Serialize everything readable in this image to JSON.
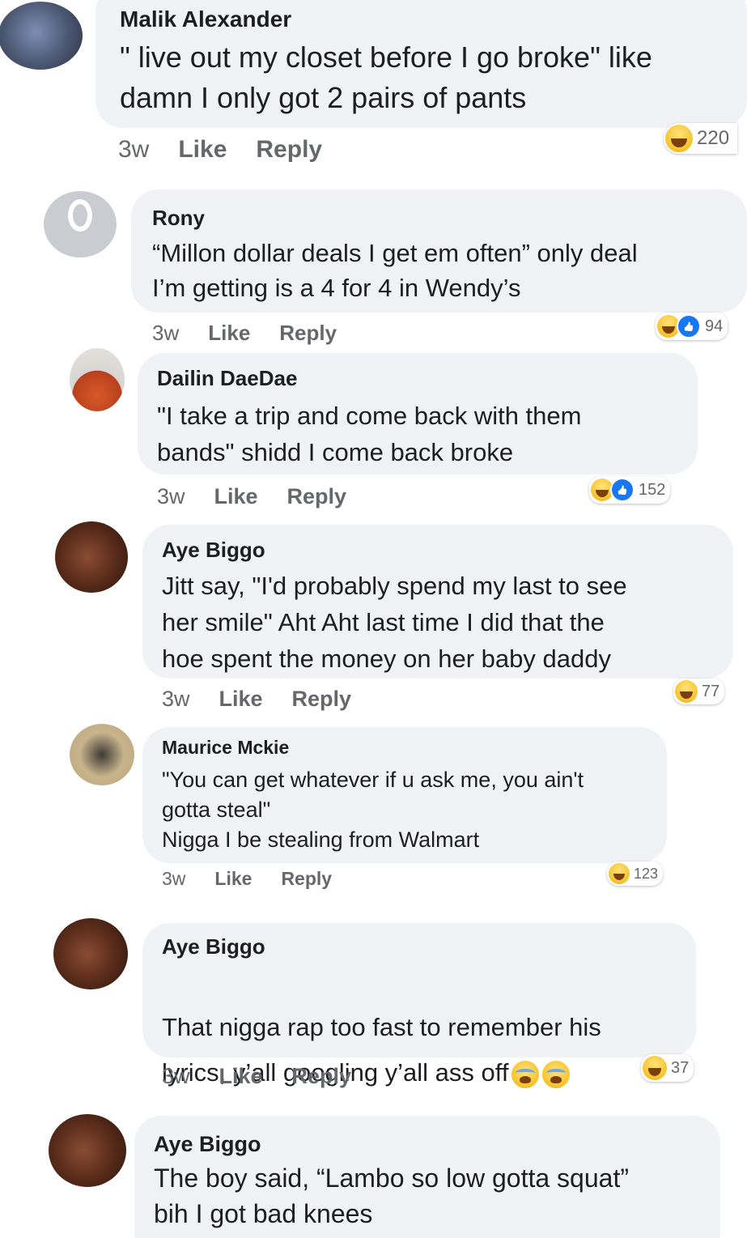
{
  "comments": [
    {
      "name": "Malik Alexander",
      "text": "\" live out my closet before I go broke\" like\ndamn I only got 2 pairs of pants",
      "time": "3w",
      "like": "Like",
      "reply": "Reply",
      "reaction_icons": [
        "haha-icon"
      ],
      "reaction_count": "220"
    },
    {
      "name": "Rony",
      "text": "“Millon dollar deals I get em often” only deal\nI’m getting is a 4 for 4 in Wendy’s",
      "time": "3w",
      "like": "Like",
      "reply": "Reply",
      "reaction_icons": [
        "haha-icon",
        "like-icon"
      ],
      "reaction_count": "94"
    },
    {
      "name": "Dailin DaeDae",
      "text": "\"I take a trip and come back with them\nbands\" shidd I come back broke",
      "time": "3w",
      "like": "Like",
      "reply": "Reply",
      "reaction_icons": [
        "haha-icon",
        "like-icon"
      ],
      "reaction_count": "152"
    },
    {
      "name": "Aye Biggo",
      "text": "Jitt say, \"I'd probably spend my last to see\nher smile\" Aht Aht last time I did that the\nhoe spent the money on her baby daddy",
      "time": "3w",
      "like": "Like",
      "reply": "Reply",
      "reaction_icons": [
        "haha-icon"
      ],
      "reaction_count": "77"
    },
    {
      "name": "Maurice Mckie",
      "text": "\"You can get whatever if u ask me, you ain't\ngotta steal\"\nNigga I be stealing from Walmart",
      "time": "3w",
      "like": "Like",
      "reply": "Reply",
      "reaction_icons": [
        "haha-icon"
      ],
      "reaction_count": "123"
    },
    {
      "name": "Aye Biggo",
      "text": "That nigga rap too fast to remember his\nlyrics, y’all googling y’all ass off",
      "time": "3w",
      "like": "Like",
      "reply": "Reply",
      "reaction_icons": [
        "haha-icon"
      ],
      "reaction_count": "37",
      "inline_emojis": [
        "crying-laughing-icon",
        "crying-laughing-icon"
      ]
    },
    {
      "name": "Aye Biggo",
      "text": "The boy said, “Lambo so low gotta squat”\nbih I got bad knees"
    }
  ],
  "colors": {
    "bubble": "#f0f2f5",
    "meta_text": "#65676b",
    "like_blue": "#1877f2",
    "haha_yellow": "#f7c22b"
  }
}
